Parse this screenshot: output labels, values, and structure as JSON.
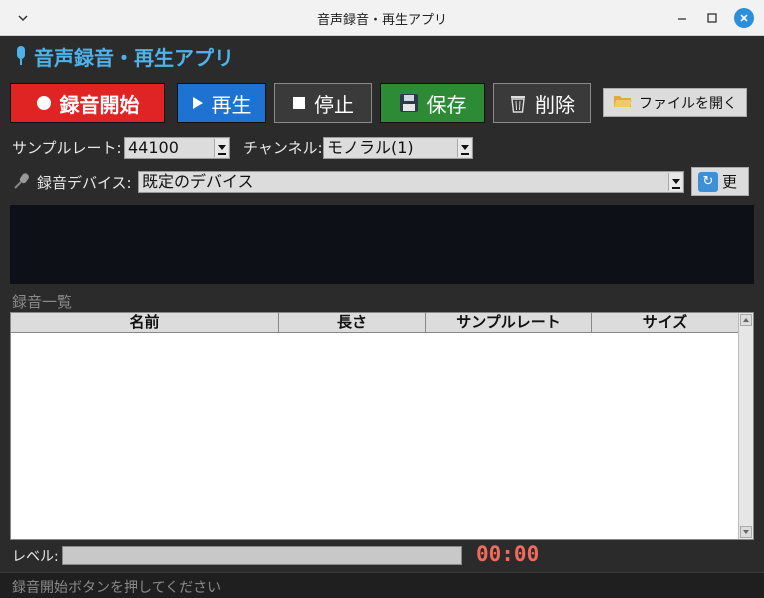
{
  "window": {
    "title": "音声録音・再生アプリ"
  },
  "app": {
    "title": "音声録音・再生アプリ",
    "accent": "#4db3ea"
  },
  "toolbar": {
    "record_label": "録音開始",
    "play_label": "再生",
    "stop_label": "停止",
    "save_label": "保存",
    "delete_label": "削除",
    "open_file_label": "ファイルを開く"
  },
  "settings": {
    "sample_rate_label": "サンプルレート:",
    "sample_rate_value": "44100",
    "channel_label": "チャンネル:",
    "channel_value": "モノラル(1)",
    "device_label": "録音デバイス:",
    "device_value": "既定のデバイス",
    "refresh_label": "更"
  },
  "recordings": {
    "section_label": "録音一覧",
    "columns": [
      "名前",
      "長さ",
      "サンプルレート",
      "サイズ"
    ],
    "rows": []
  },
  "level": {
    "label": "レベル:",
    "value": 0,
    "timer": "00:00"
  },
  "status": {
    "text": "録音開始ボタンを押してください"
  },
  "colors": {
    "record": "#e02424",
    "play": "#1e73d2",
    "save": "#2e8b35",
    "timer": "#f06b5c"
  }
}
